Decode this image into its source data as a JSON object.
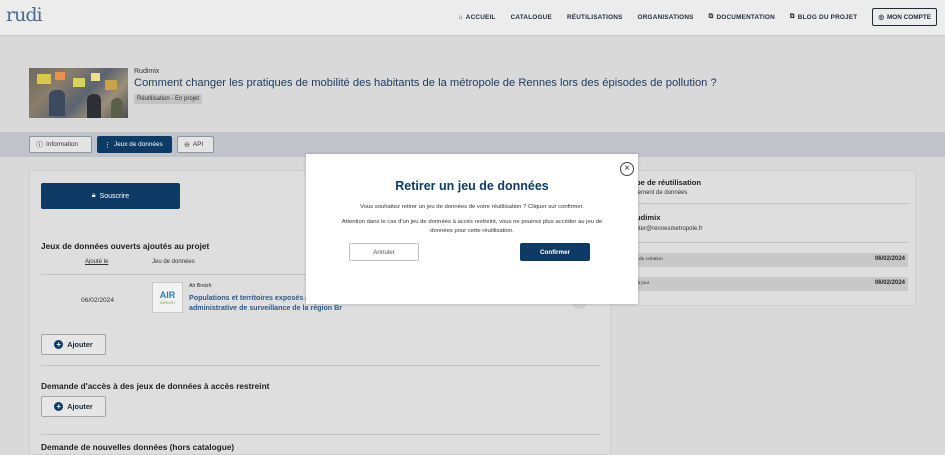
{
  "header": {
    "logo": "rudi",
    "nav": {
      "home": "ACCUEIL",
      "catalog": "CATALOGUE",
      "reuses": "RÉUTILISATIONS",
      "organisations": "ORGANISATIONS",
      "documentation": "DOCUMENTATION",
      "blog": "BLOG DU PROJET",
      "account": "MON COMPTE"
    }
  },
  "project": {
    "brand": "Rudimix",
    "title": "Comment changer les pratiques de mobilité des habitants de la métropole de Rennes lors des épisodes de pollution ?",
    "badge": "Réutilisation - En projet"
  },
  "tabs": {
    "information": "Information",
    "datasets": "Jeux de données",
    "api": "API"
  },
  "main": {
    "subscribe": "Souscrire",
    "open_section_title": "Jeux de données ouverts ajoutés au projet",
    "col_added": "Ajouté le",
    "col_dataset": "Jeu de données",
    "rows": [
      {
        "date": "06/02/2024",
        "logo_main": "AIR",
        "logo_sub": "BREIZH",
        "org": "Air Breizh",
        "title": "Populations et territoires exposés à Dioxyde d'Azote (NO2) par zone administrative de surveillance de la région Br"
      }
    ],
    "add_label": "Ajouter",
    "restricted_section_title": "Demande d'accès à des jeux de données à accès restreint",
    "new_data_section_title": "Demande de nouvelles données (hors catalogue)"
  },
  "side": {
    "type_label": "pe de réutilisation",
    "type_value": "tement de données",
    "producer": "udimix",
    "email": "ster@rennesmetropole.fr",
    "created_label": "ate de création",
    "created_value": "06/02/2024",
    "updated_label": "se à jour",
    "updated_value": "06/02/2024"
  },
  "modal": {
    "title": "Retirer un jeu de données",
    "line1": "Vous souhaitez retirer un jeu de données de votre réutilisation ? Cliquer sur confirmer.",
    "line2": "Attention dans le cas d'un jeu de données à accès restreint, vous ne pourrez plus accéder au jeu de données pour cette réutilisation.",
    "cancel": "Annuler",
    "confirm": "Confirmer",
    "close": "×"
  },
  "colors": {
    "primary": "#0d3b66",
    "link": "#2f5a86",
    "overlay_bg": "#d9d9d9"
  }
}
